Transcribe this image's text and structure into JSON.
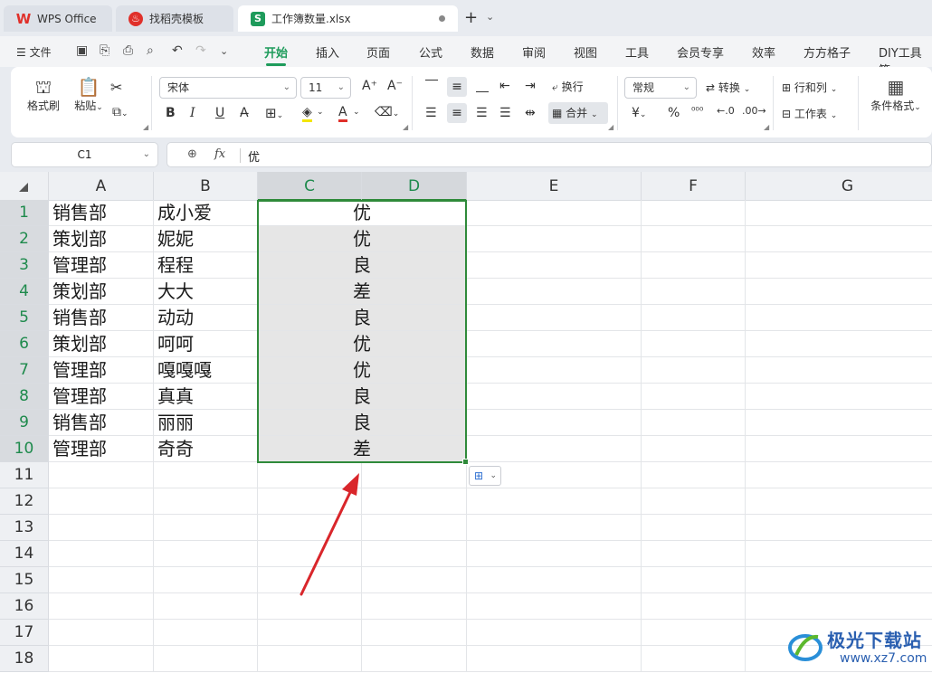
{
  "tabs": [
    {
      "label": "WPS Office",
      "icon": "wps-logo-icon"
    },
    {
      "label": "找稻壳模板",
      "icon": "docer-icon"
    },
    {
      "label": "工作簿数量.xlsx",
      "icon": "sheet-file-icon"
    }
  ],
  "menu": {
    "file": "文件",
    "items": [
      "开始",
      "插入",
      "页面",
      "公式",
      "数据",
      "审阅",
      "视图",
      "工具",
      "会员专享",
      "效率",
      "方方格子",
      "DIY工具箱"
    ],
    "active": "开始"
  },
  "ribbon": {
    "format_painter": "格式刷",
    "paste": "粘贴",
    "font_name": "宋体",
    "font_size": "11",
    "wrap": "换行",
    "merge": "合并",
    "number_format": "常规",
    "convert": "转换",
    "row_col": "行和列",
    "worksheet": "工作表",
    "cond_format": "条件格式",
    "bold": "B",
    "italic": "I",
    "underline": "U",
    "currency": "¥",
    "percent": "%"
  },
  "formula_bar": {
    "cell_ref": "C1",
    "fx": "fx",
    "value": "优"
  },
  "sheet": {
    "columns": [
      "A",
      "B",
      "C",
      "D",
      "E",
      "F",
      "G"
    ],
    "rows": [
      "1",
      "2",
      "3",
      "4",
      "5",
      "6",
      "7",
      "8",
      "9",
      "10",
      "11",
      "12",
      "13",
      "14",
      "15",
      "16",
      "17",
      "18"
    ],
    "data": [
      [
        "销售部",
        "成小爱",
        "优"
      ],
      [
        "策划部",
        "妮妮",
        "优"
      ],
      [
        "管理部",
        "程程",
        "良"
      ],
      [
        "策划部",
        "大大",
        "差"
      ],
      [
        "销售部",
        "动动",
        "良"
      ],
      [
        "策划部",
        "呵呵",
        "优"
      ],
      [
        "管理部",
        "嘎嘎嘎",
        "优"
      ],
      [
        "管理部",
        "真真",
        "良"
      ],
      [
        "销售部",
        "丽丽",
        "良"
      ],
      [
        "管理部",
        "奇奇",
        "差"
      ]
    ],
    "selected_range": "C1:D10"
  },
  "watermark": {
    "cn": "极光下载站",
    "url": "www.xz7.com"
  },
  "colors": {
    "accent": "#1e9b5b",
    "selection": "#2f8a3a",
    "arrow": "#d9262b"
  }
}
